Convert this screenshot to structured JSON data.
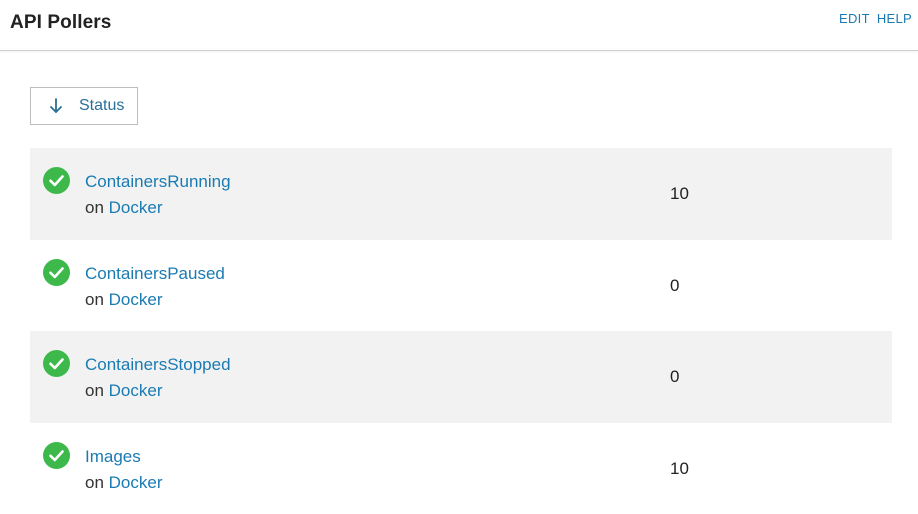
{
  "header": {
    "title": "API Pollers",
    "links": [
      {
        "label": "EDIT"
      },
      {
        "label": "HELP"
      }
    ]
  },
  "sort": {
    "label": "Status",
    "icon": "arrow-down-icon"
  },
  "colors": {
    "link": "#1a7bb3",
    "status_ok": "#3cb94a",
    "row_shade": "#f2f2f2"
  },
  "pollers": [
    {
      "name": "ContainersRunning",
      "on_prefix": "on",
      "source": "Docker",
      "value": "10",
      "status": "ok"
    },
    {
      "name": "ContainersPaused",
      "on_prefix": "on",
      "source": "Docker",
      "value": "0",
      "status": "ok"
    },
    {
      "name": "ContainersStopped",
      "on_prefix": "on",
      "source": "Docker",
      "value": "0",
      "status": "ok"
    },
    {
      "name": "Images",
      "on_prefix": "on",
      "source": "Docker",
      "value": "10",
      "status": "ok"
    }
  ]
}
